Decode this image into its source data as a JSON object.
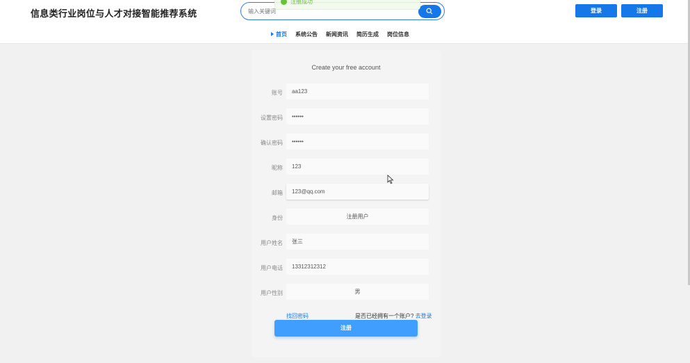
{
  "header": {
    "site_title": "信息类行业岗位与人才对接智能推荐系统",
    "search_placeholder": "输入关键词",
    "login_label": "登录",
    "register_label": "注册"
  },
  "toast": {
    "message": "注册成功"
  },
  "nav": {
    "items": [
      {
        "label": "首页",
        "active": true
      },
      {
        "label": "系统公告"
      },
      {
        "label": "新闻资讯"
      },
      {
        "label": "简历生成"
      },
      {
        "label": "岗位信息"
      }
    ]
  },
  "form": {
    "title": "Create your free account",
    "fields": [
      {
        "label": "账号",
        "value": "aa123"
      },
      {
        "label": "设置密码",
        "value": "••••••"
      },
      {
        "label": "确认密码",
        "value": "••••••"
      },
      {
        "label": "昵称",
        "value": "123"
      },
      {
        "label": "邮箱",
        "value": "123@qq.com"
      },
      {
        "label": "身份",
        "value": "注册用户"
      },
      {
        "label": "用户姓名",
        "value": "张三"
      },
      {
        "label": "用户电话",
        "value": "13312312312"
      },
      {
        "label": "用户性别",
        "value": "男"
      }
    ],
    "forgot_password": "找回密码",
    "have_account": "是否已经拥有一个账户?",
    "go_login": "去登录",
    "submit_label": "注册"
  },
  "colors": {
    "primary": "#1677e8",
    "submit": "#409eff",
    "success": "#67c23a"
  }
}
